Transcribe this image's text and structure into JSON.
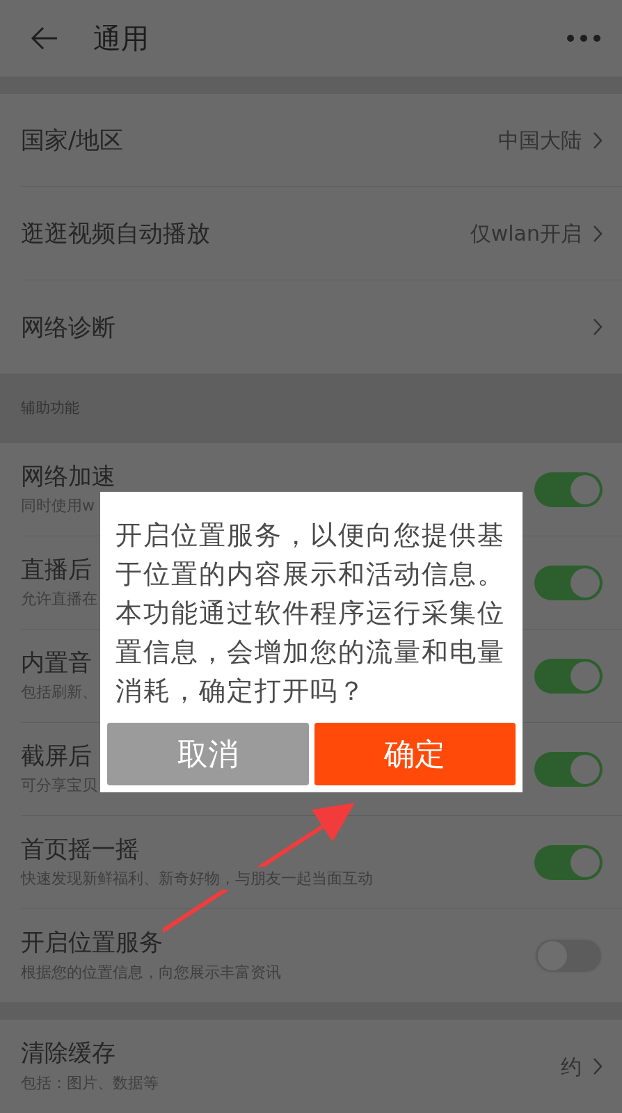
{
  "header": {
    "title": "通用"
  },
  "general_items": [
    {
      "title": "国家/地区",
      "value": "中国大陆"
    },
    {
      "title": "逛逛视频自动播放",
      "value": "仅wlan开启"
    },
    {
      "title": "网络诊断"
    }
  ],
  "section_title": "辅助功能",
  "toggles": [
    {
      "title": "网络加速",
      "subtitle": "同时使用w",
      "on": true
    },
    {
      "title": "直播后",
      "subtitle": "允许直播在",
      "on": true
    },
    {
      "title": "内置音",
      "subtitle": "包括刷新、",
      "on": true
    },
    {
      "title": "截屏后",
      "subtitle": "可分享宝贝",
      "on": true
    },
    {
      "title": "首页摇一摇",
      "subtitle": "快速发现新鲜福利、新奇好物，与朋友一起当面互动",
      "on": true
    },
    {
      "title": "开启位置服务",
      "subtitle": "根据您的位置信息，向您展示丰富资讯",
      "on": false
    }
  ],
  "cache": {
    "title": "清除缓存",
    "subtitle": "包括：图片、数据等",
    "value": "约"
  },
  "dialog": {
    "message": "开启位置服务，以便向您提供基于位置的内容展示和活动信息。本功能通过软件程序运行采集位置信息，会增加您的流量和电量消耗，确定打开吗？",
    "buttons": [
      {
        "label": "取消",
        "kind": "cancel"
      },
      {
        "label": "确定",
        "kind": "confirm"
      }
    ]
  }
}
